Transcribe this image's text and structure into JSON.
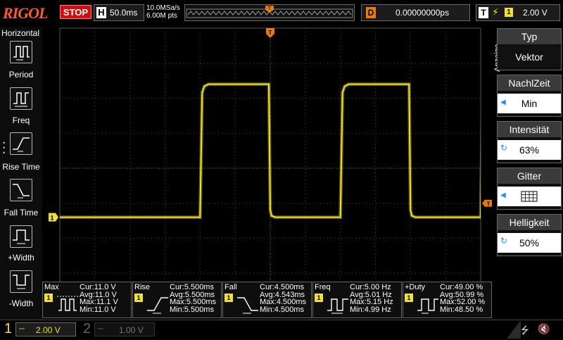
{
  "brand": "RIGOL",
  "run_state": "STOP",
  "horizontal": {
    "label": "H",
    "timebase": "50.0ms",
    "sample_rate": "10.0MSa/s",
    "memory": "6.00M pts"
  },
  "delay": {
    "label": "D",
    "value": "0.00000000ps"
  },
  "trigger": {
    "label": "T",
    "source": "1",
    "level": "2.00 V"
  },
  "left_menu": {
    "title": "Horizontal",
    "items": [
      {
        "label": "Period",
        "icon": "period-icon"
      },
      {
        "label": "Freq",
        "icon": "freq-icon"
      },
      {
        "label": "Rise Time",
        "icon": "rise-time-icon"
      },
      {
        "label": "Fall Time",
        "icon": "fall-time-icon"
      },
      {
        "label": "+Width",
        "icon": "positive-width-icon"
      },
      {
        "label": "-Width",
        "icon": "negative-width-icon"
      }
    ]
  },
  "right_menu": {
    "title": "Anzeige",
    "items": [
      {
        "label": "Typ",
        "value": "Vektor"
      },
      {
        "label": "NachlZeit",
        "value": "Min"
      },
      {
        "label": "Intensität",
        "value": "63%"
      },
      {
        "label": "Gitter",
        "value": "grid-full-icon"
      },
      {
        "label": "Helligkeit",
        "value": "50%"
      }
    ]
  },
  "waveform": {
    "channel": "1",
    "color": "#f0e030",
    "high_level_div": 2.4,
    "low_level_div": -1.4,
    "period_s": 0.2,
    "duty_percent": 49,
    "time_per_div_s": 0.05,
    "first_rising_edge_s": 0.2,
    "trigger_marker": "T"
  },
  "measurements": [
    {
      "name": "Max",
      "lines": [
        "Cur:11.0 V",
        "Avg:11.0 V",
        "Max:11.1 V",
        "Min:11.0 V"
      ],
      "icon": "max-icon"
    },
    {
      "name": "Rise",
      "lines": [
        "Cur:5.500ms",
        "Avg:5.500ms",
        "Max:5.500ms",
        "Min:5.500ms"
      ],
      "icon": "rise-icon"
    },
    {
      "name": "Fall",
      "lines": [
        "Cur:4.500ms",
        "Avg:4.543ms",
        "Max:4.500ms",
        "Min:4.500ms"
      ],
      "icon": "fall-icon"
    },
    {
      "name": "Freq",
      "lines": [
        "Cur:5.00 Hz",
        "Avg:5.01 Hz",
        "Max:5.15 Hz",
        "Min:4.99 Hz"
      ],
      "icon": "freq-icon"
    },
    {
      "name": "+Duty",
      "lines": [
        "Cur:49.00 %",
        "Avg:50.99 %",
        "Max:52.00 %",
        "Min:48.50 %"
      ],
      "icon": "duty-icon"
    }
  ],
  "measurement_channel": "1",
  "channels": [
    {
      "num": "1",
      "scale": "2.00 V",
      "coupling": "⎓",
      "active": true
    },
    {
      "num": "2",
      "scale": "1.00 V",
      "coupling": "⎓",
      "active": false
    }
  ]
}
